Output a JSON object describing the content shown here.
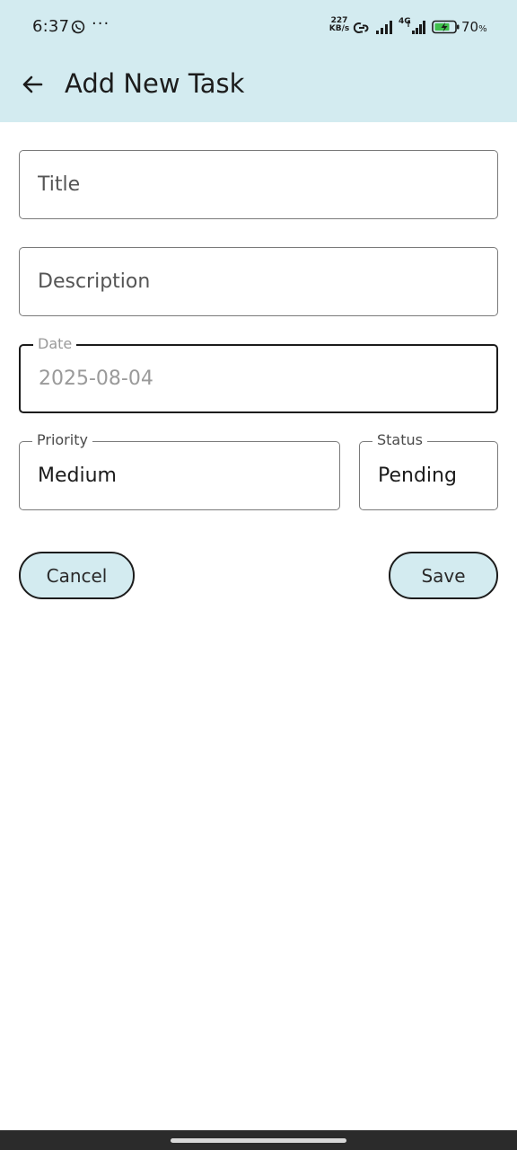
{
  "status_bar": {
    "time": "6:37",
    "more_indicator": "···",
    "speed_value": "227",
    "speed_unit": "KB/s",
    "network": "4G",
    "battery_percent": "70",
    "battery_unit": "%",
    "icons": [
      "whatsapp-icon",
      "link-icon",
      "signal-icon",
      "signal-icon",
      "battery-charging-icon"
    ]
  },
  "app_bar": {
    "back_icon": "arrow-left-icon",
    "title": "Add New Task"
  },
  "form": {
    "title": {
      "value": "",
      "placeholder": "Title"
    },
    "description": {
      "value": "",
      "placeholder": "Description"
    },
    "date": {
      "label": "Date",
      "value": "2025-08-04"
    },
    "priority": {
      "label": "Priority",
      "value": "Medium"
    },
    "status": {
      "label": "Status",
      "value": "Pending"
    }
  },
  "actions": {
    "cancel_label": "Cancel",
    "save_label": "Save"
  },
  "colors": {
    "app_bar": "#d3ebf0",
    "button_fill": "#d3ebf0",
    "text": "#1c1c1c",
    "field_border": "#7a7a7a",
    "disabled_text": "#9a9a9a"
  }
}
